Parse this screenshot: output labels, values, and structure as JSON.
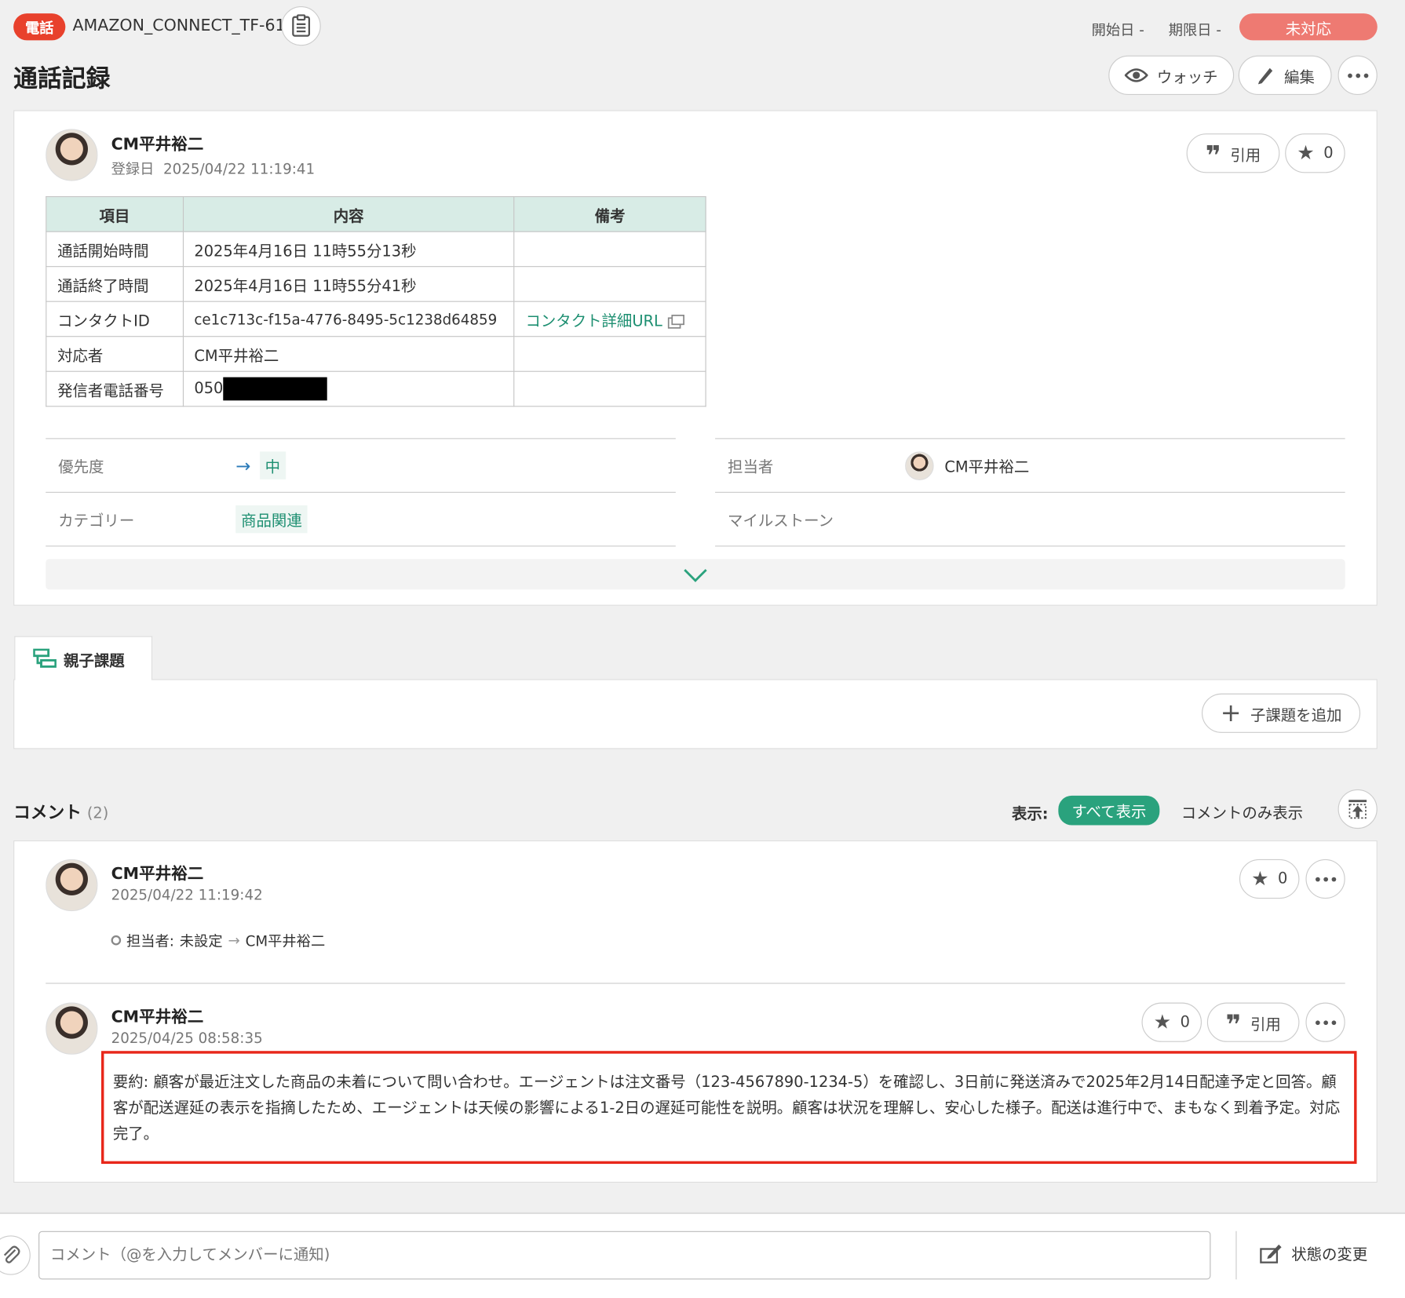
{
  "header": {
    "type_label": "電話",
    "issue_key": "AMAZON_CONNECT_TF-61",
    "start_label": "開始日",
    "start_value": "-",
    "due_label": "期限日",
    "due_value": "-",
    "status": "未対応",
    "title": "通話記録",
    "watch_label": "ウォッチ",
    "edit_label": "編集"
  },
  "issue": {
    "author": "CM平井裕二",
    "registered_label": "登録日",
    "registered_at": "2025/04/22 11:19:41",
    "quote_label": "引用",
    "star_count": "0",
    "table": {
      "headers": [
        "項目",
        "内容",
        "備考"
      ],
      "rows": [
        {
          "item": "通話開始時間",
          "content": "2025年4月16日 11時55分13秒",
          "note": ""
        },
        {
          "item": "通話終了時間",
          "content": "2025年4月16日 11時55分41秒",
          "note": ""
        },
        {
          "item": "コンタクトID",
          "content": "ce1c713c-f15a-4776-8495-5c1238d64859",
          "note": "コンタクト詳細URL"
        },
        {
          "item": "対応者",
          "content": "CM平井裕二",
          "note": ""
        },
        {
          "item": "発信者電話番号",
          "content": "050",
          "note": ""
        }
      ]
    },
    "props": {
      "priority_label": "優先度",
      "priority_value": "中",
      "assignee_label": "担当者",
      "assignee_value": "CM平井裕二",
      "category_label": "カテゴリー",
      "category_value": "商品関連",
      "milestone_label": "マイルストーン"
    }
  },
  "subtasks": {
    "tab_label": "親子課題",
    "add_label": "子課題を追加"
  },
  "comments": {
    "title": "コメント",
    "count": "(2)",
    "display_label": "表示:",
    "show_all": "すべて表示",
    "comments_only": "コメントのみ表示",
    "items": [
      {
        "author": "CM平井裕二",
        "date": "2025/04/22 11:19:42",
        "star_count": "0",
        "change_field": "担当者:",
        "change_from": "未設定",
        "change_to": "CM平井裕二"
      },
      {
        "author": "CM平井裕二",
        "date": "2025/04/25 08:58:35",
        "star_count": "0",
        "quote_label": "引用",
        "body": "要約: 顧客が最近注文した商品の未着について問い合わせ。エージェントは注文番号（123-4567890-1234-5）を確認し、3日前に発送済みで2025年2月14日配達予定と回答。顧客が配送遅延の表示を指摘したため、エージェントは天候の影響による1-2日の遅延可能性を説明。顧客は状況を理解し、安心した様子。配送は進行中で、まもなく到着予定。対応完了。"
      }
    ]
  },
  "footer": {
    "comment_placeholder": "コメント（@を入力してメンバーに通知)",
    "status_change_label": "状態の変更"
  },
  "colors": {
    "accent": "#2aa27d",
    "type_badge": "#e8412c",
    "status_badge": "#ee7a72",
    "highlight_border": "#e8271a"
  }
}
